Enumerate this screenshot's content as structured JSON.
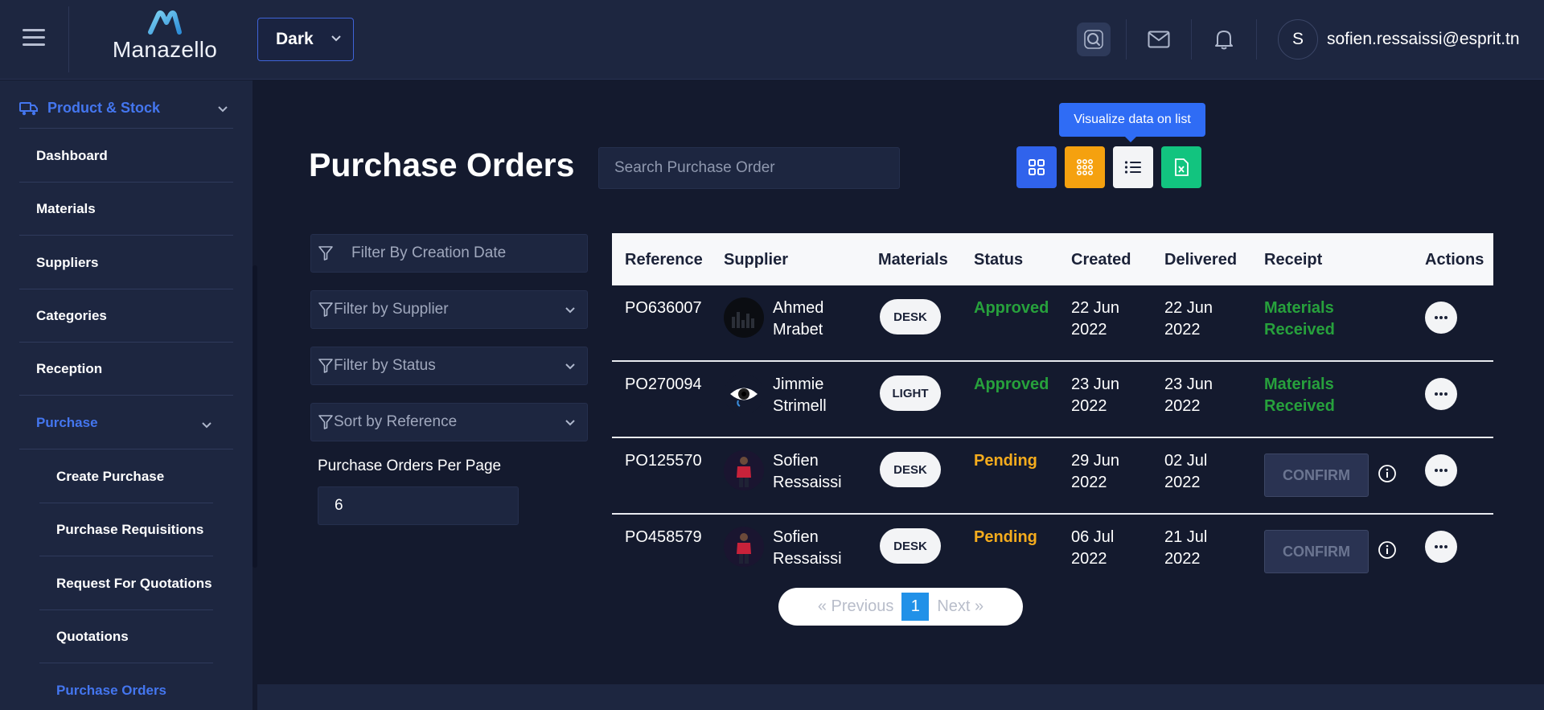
{
  "header": {
    "logo_text": "Manazello",
    "theme": "Dark",
    "user_initial": "S",
    "user_email": "sofien.ressaissi@esprit.tn"
  },
  "sidebar": {
    "section": "Product & Stock",
    "items": [
      {
        "label": "Dashboard"
      },
      {
        "label": "Materials"
      },
      {
        "label": "Suppliers"
      },
      {
        "label": "Categories"
      },
      {
        "label": "Reception"
      },
      {
        "label": "Purchase"
      }
    ],
    "sub_items": [
      {
        "label": "Create Purchase"
      },
      {
        "label": "Purchase Requisitions"
      },
      {
        "label": "Request For Quotations"
      },
      {
        "label": "Quotations"
      },
      {
        "label": "Purchase Orders"
      }
    ]
  },
  "main": {
    "title": "Purchase Orders",
    "search_placeholder": "Search Purchase Order",
    "tooltip": "Visualize data on list",
    "filters": [
      {
        "label": "Filter By Creation Date"
      },
      {
        "label": "Filter by Supplier"
      },
      {
        "label": "Filter by Status"
      },
      {
        "label": "Sort by Reference"
      }
    ],
    "per_page_label": "Purchase Orders Per Page",
    "per_page_value": "6"
  },
  "table": {
    "headers": [
      "Reference",
      "Supplier",
      "Materials",
      "Status",
      "Created",
      "Delivered",
      "Receipt",
      "Actions"
    ],
    "rows": [
      {
        "ref": "PO636007",
        "supplier_1": "Ahmed",
        "supplier_2": "Mrabet",
        "material": "DESK",
        "status": "Approved",
        "created_1": "22 Jun",
        "created_2": "2022",
        "delivered_1": "22 Jun",
        "delivered_2": "2022",
        "receipt_1": "Materials",
        "receipt_2": "Received"
      },
      {
        "ref": "PO270094",
        "supplier_1": "Jimmie",
        "supplier_2": "Strimell",
        "material": "LIGHT",
        "status": "Approved",
        "created_1": "23 Jun",
        "created_2": "2022",
        "delivered_1": "23 Jun",
        "delivered_2": "2022",
        "receipt_1": "Materials",
        "receipt_2": "Received"
      },
      {
        "ref": "PO125570",
        "supplier_1": "Sofien",
        "supplier_2": "Ressaissi",
        "material": "DESK",
        "status": "Pending",
        "created_1": "29 Jun",
        "created_2": "2022",
        "delivered_1": "02 Jul",
        "delivered_2": "2022",
        "confirm": "CONFIRM"
      },
      {
        "ref": "PO458579",
        "supplier_1": "Sofien",
        "supplier_2": "Ressaissi",
        "material": "DESK",
        "status": "Pending",
        "created_1": "06 Jul",
        "created_2": "2022",
        "delivered_1": "21 Jul",
        "delivered_2": "2022",
        "confirm": "CONFIRM"
      }
    ]
  },
  "pagination": {
    "prev": "«  Previous",
    "current": "1",
    "next": "Next  »"
  },
  "colors": {
    "accent": "#4476ef",
    "approved": "#27a13c",
    "pending": "#f5ac1d",
    "grid_view": "#3063ec",
    "apps_view": "#f5a10f",
    "list_view": "#f3f4f6",
    "excel": "#12c47f"
  }
}
